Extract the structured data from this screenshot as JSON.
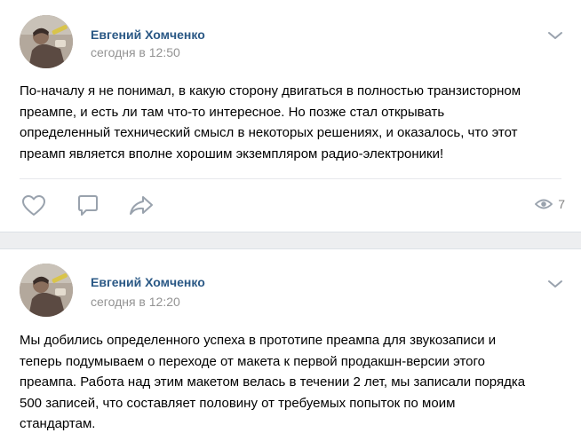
{
  "posts": [
    {
      "author": "Евгений Хомченко",
      "time": "сегодня в 12:50",
      "text_lines": [
        "По-началу я не понимал, в какую сторону двигаться в полностью транзисторном",
        "преампе, и есть ли там что-то интересное. Но позже стал открывать",
        "определенный технический смысл в некоторых решениях, и оказалось, что этот",
        "преамп является вполне хорошим экземпляром радио-электроники!"
      ],
      "views": "7",
      "icons": {
        "like": "heart-icon",
        "comment": "comment-icon",
        "share": "share-arrow-icon",
        "views": "eye-icon",
        "menu": "chevron-down-icon"
      }
    },
    {
      "author": "Евгений Хомченко",
      "time": "сегодня в 12:20",
      "text_lines": [
        "Мы добились определенного успеха в прототипе преампа для звукозаписи и",
        "теперь подумываем о переходе от макета к первой продакшн-версии этого",
        "преампа. Работа над этим макетом велась в течении 2 лет, мы записали порядка",
        "500 записей, что составляет половину от требуемых попыток по моим",
        "стандартам."
      ],
      "icons": {
        "menu": "chevron-down-icon"
      }
    }
  ],
  "colors": {
    "author": "#2a5885",
    "time": "#939393",
    "icon": "#99a2ad",
    "background": "#edeef0"
  }
}
